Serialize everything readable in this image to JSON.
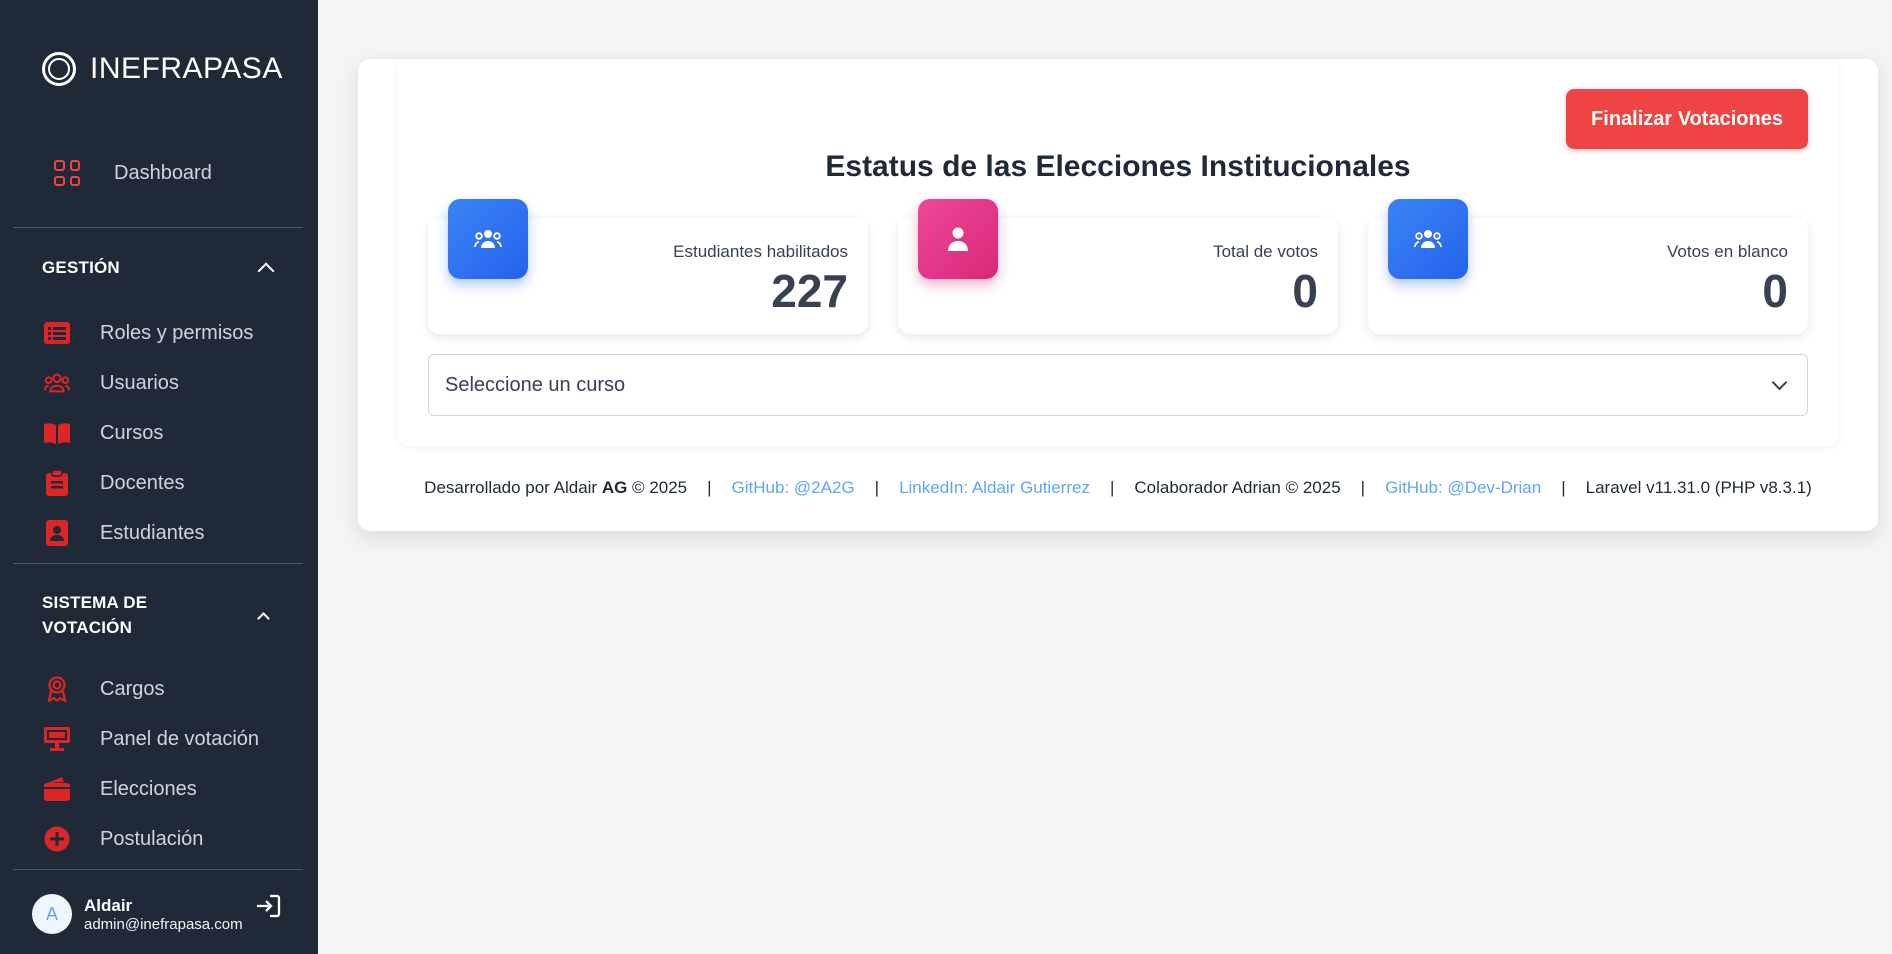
{
  "brand": {
    "name": "INEFRAPASA"
  },
  "sidebar": {
    "dashboard_label": "Dashboard",
    "gestion": {
      "title": "GESTIÓN",
      "items": [
        {
          "label": "Roles y permisos",
          "icon": "list-icon"
        },
        {
          "label": "Usuarios",
          "icon": "users-icon"
        },
        {
          "label": "Cursos",
          "icon": "book-icon"
        },
        {
          "label": "Docentes",
          "icon": "clipboard-user-icon"
        },
        {
          "label": "Estudiantes",
          "icon": "id-badge-icon"
        }
      ]
    },
    "votacion": {
      "title_line1": "SISTEMA DE",
      "title_line2": "VOTACIÓN",
      "items": [
        {
          "label": "Cargos",
          "icon": "award-icon"
        },
        {
          "label": "Panel de votación",
          "icon": "monitor-icon"
        },
        {
          "label": "Elecciones",
          "icon": "wallet-icon"
        },
        {
          "label": "Postulación",
          "icon": "plus-circle-icon"
        }
      ]
    },
    "user": {
      "initial": "A",
      "name": "Aldair",
      "email": "admin@inefrapasa.com"
    }
  },
  "main": {
    "finish_button": "Finalizar Votaciones",
    "title": "Estatus de las Elecciones Institucionales",
    "cards": [
      {
        "label": "Estudiantes habilitados",
        "value": "227",
        "color": "#2563eb"
      },
      {
        "label": "Total de votos",
        "value": "0",
        "color": "#db2777"
      },
      {
        "label": "Votos en blanco",
        "value": "0",
        "color": "#2563eb"
      }
    ],
    "select_placeholder": "Seleccione un curso"
  },
  "footer": {
    "dev_prefix": "Desarrollado por Aldair ",
    "dev_bold": "AG",
    "dev_suffix": " © 2025",
    "github1": "GitHub: @2A2G",
    "linkedin": "LinkedIn: Aldair Gutierrez",
    "collab": "Colaborador Adrian © 2025",
    "github2": "GitHub: @Dev-Drian",
    "version": "Laravel v11.31.0 (PHP v8.3.1)",
    "separator": "|"
  },
  "colors": {
    "accent": "#ef4444",
    "sidebar": "#1f2937",
    "link": "#60a5fa"
  }
}
